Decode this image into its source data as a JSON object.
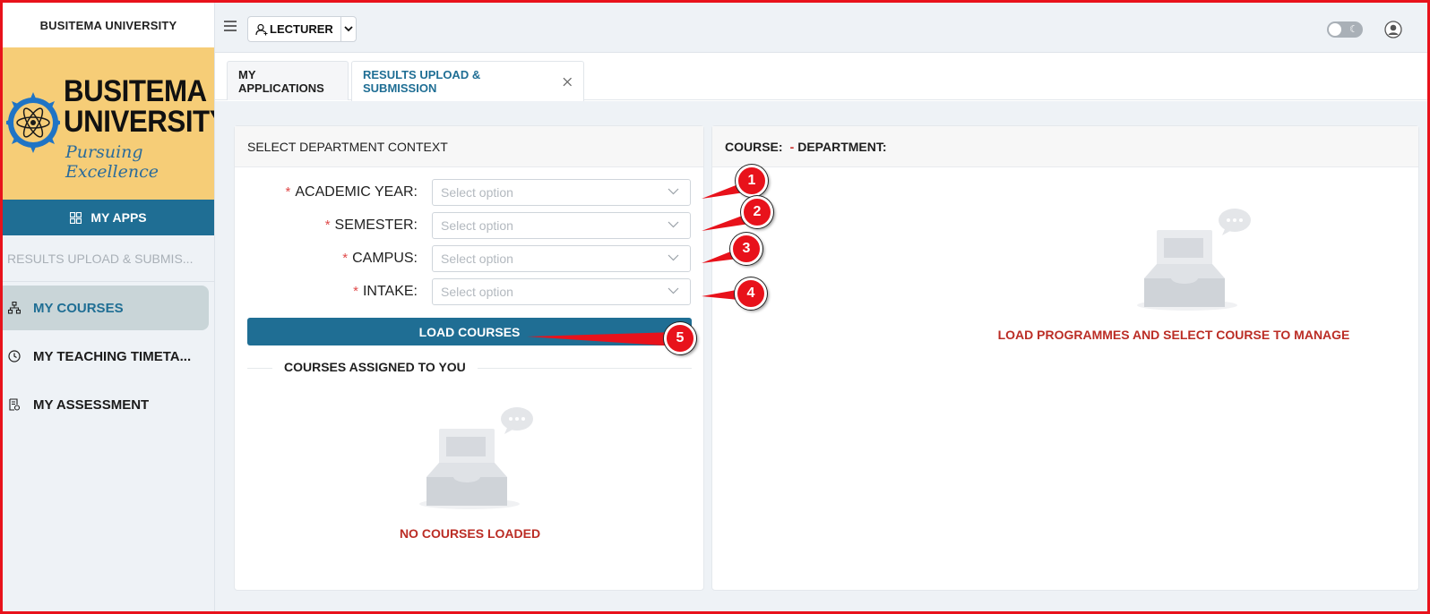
{
  "sidebar": {
    "title": "BUSITEMA UNIVERSITY",
    "logo": {
      "line1": "BUSITEMA",
      "line2": "UNIVERSITY",
      "motto": "Pursuing Excellence"
    },
    "my_apps_label": "MY APPS",
    "breadcrumb": "RESULTS UPLOAD & SUBMIS...",
    "items": [
      {
        "label": "MY COURSES",
        "icon": "sitemap-icon",
        "active": true
      },
      {
        "label": "MY TEACHING TIMETA...",
        "icon": "clock-icon",
        "active": false
      },
      {
        "label": "MY ASSESSMENT",
        "icon": "assessment-icon",
        "active": false
      }
    ]
  },
  "topbar": {
    "role_label": "LECTURER",
    "icons": [
      "menu-icon",
      "user-switch-icon",
      "chevron-down-icon",
      "theme-toggle",
      "avatar-icon"
    ]
  },
  "tabs": [
    {
      "label": "MY APPLICATIONS",
      "active": false
    },
    {
      "label": "RESULTS UPLOAD & SUBMISSION",
      "active": true,
      "closable": true
    }
  ],
  "left_panel": {
    "header": "SELECT DEPARTMENT CONTEXT",
    "fields": [
      {
        "label": "ACADEMIC YEAR",
        "placeholder": "Select option",
        "required": true
      },
      {
        "label": "SEMESTER",
        "placeholder": "Select option",
        "required": true
      },
      {
        "label": "CAMPUS",
        "placeholder": "Select option",
        "required": true
      },
      {
        "label": "INTAKE",
        "placeholder": "Select option",
        "required": true
      }
    ],
    "load_button": "LOAD COURSES",
    "assigned_heading": "COURSES ASSIGNED TO YOU",
    "empty_text": "NO COURSES LOADED"
  },
  "right_panel": {
    "course_label": "COURSE:",
    "dash": "-",
    "department_label": "DEPARTMENT:",
    "empty_text": "LOAD PROGRAMMES AND SELECT COURSE TO MANAGE"
  },
  "annotations": [
    "1",
    "2",
    "3",
    "4",
    "5"
  ],
  "colors": {
    "primary": "#1f6e94",
    "danger_text": "#bb2d25",
    "annotation": "#e8121b",
    "logo_bg": "#f6cd77"
  }
}
